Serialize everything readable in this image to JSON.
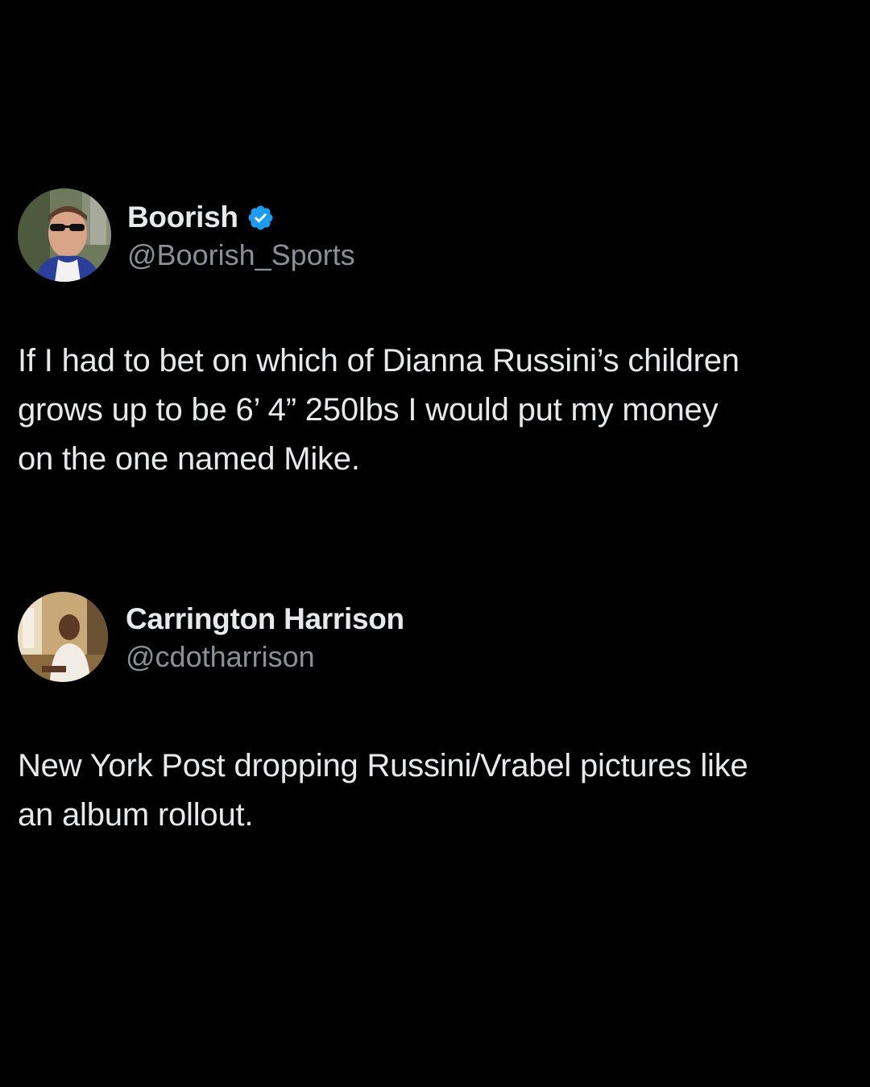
{
  "tweets": [
    {
      "display_name": "Boorish",
      "handle": "@Boorish_Sports",
      "verified": true,
      "avatar_icon": "profile-photo-man-sunglasses",
      "text": "If I had to bet on which of Dianna Russini’s children\ngrows up to be 6’ 4” 250lbs I would put my money\non the one named Mike."
    },
    {
      "display_name": "Carrington Harrison",
      "handle": "@cdotharrison",
      "verified": false,
      "avatar_icon": "profile-photo-man-seated",
      "text": "New York Post dropping Russini/Vrabel pictures like\nan album rollout."
    }
  ],
  "colors": {
    "background": "#000000",
    "primary_text": "#e7e9ea",
    "secondary_text": "#8b9096",
    "verified_badge": "#1d9bf0"
  }
}
